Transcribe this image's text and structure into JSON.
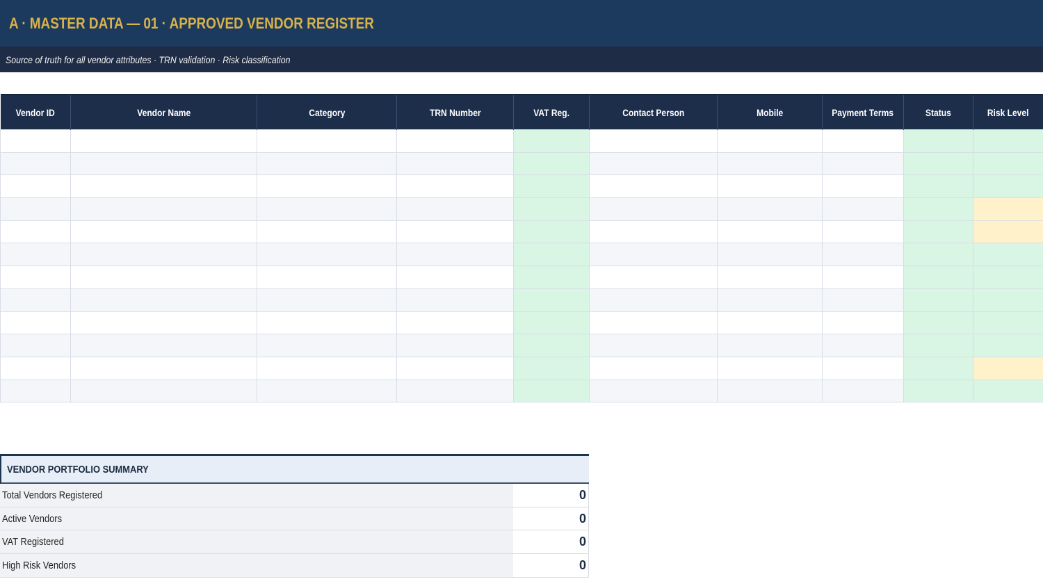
{
  "header": {
    "title": "A · MASTER DATA  —  01 · APPROVED VENDOR REGISTER",
    "subtitle": "Source of truth for all vendor attributes · TRN validation · Risk classification"
  },
  "register": {
    "columns": [
      "Vendor ID",
      "Vendor Name",
      "Category",
      "TRN Number",
      "VAT Reg.",
      "Contact Person",
      "Mobile",
      "Payment Terms",
      "Status",
      "Risk Level"
    ],
    "row_count": 12,
    "risk_level_fill": [
      "green",
      "green",
      "green",
      "amber",
      "amber",
      "green",
      "green",
      "green",
      "green",
      "green",
      "amber",
      "green"
    ],
    "colors": {
      "header_bg": "#1c2e4a",
      "status_fill_green": "#d9f5e4",
      "risk_fill_amber": "#fff1c9"
    }
  },
  "summary": {
    "title": "VENDOR PORTFOLIO SUMMARY",
    "rows": [
      {
        "label": "Total Vendors Registered",
        "value": "0"
      },
      {
        "label": "Active Vendors",
        "value": "0"
      },
      {
        "label": "VAT Registered",
        "value": "0"
      },
      {
        "label": "High Risk Vendors",
        "value": "0"
      }
    ]
  }
}
